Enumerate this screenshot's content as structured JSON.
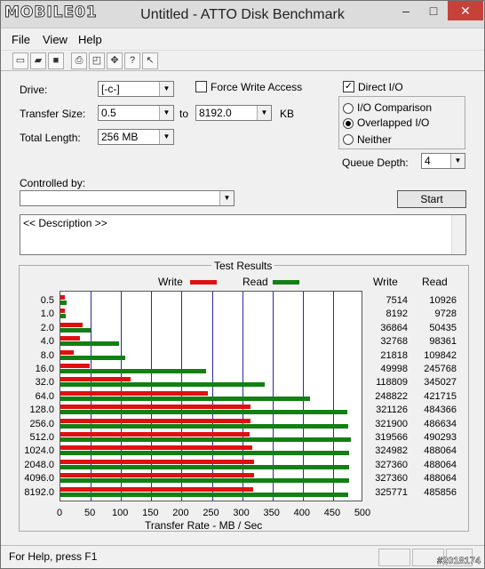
{
  "window": {
    "title": "Untitled - ATTO Disk Benchmark",
    "logo": "MOBILE01"
  },
  "titlebar_buttons": {
    "minimize": "–",
    "maximize": "□",
    "close": "✕"
  },
  "menu": [
    "File",
    "View",
    "Help"
  ],
  "toolbar_icons": [
    "new-icon",
    "open-icon",
    "save-icon",
    "print-icon",
    "print-preview-icon",
    "move-icon",
    "help-icon",
    "context-help-icon"
  ],
  "settings": {
    "drive_label": "Drive:",
    "drive_value": "[-c-]",
    "force_write_label": "Force Write Access",
    "force_write_checked": false,
    "direct_io_label": "Direct I/O",
    "direct_io_checked": true,
    "transfer_label": "Transfer Size:",
    "transfer_from": "0.5",
    "transfer_to_label": "to",
    "transfer_to": "8192.0",
    "transfer_unit": "KB",
    "total_label": "Total Length:",
    "total_value": "256 MB",
    "io_options": [
      "I/O Comparison",
      "Overlapped I/O",
      "Neither"
    ],
    "io_selected": 1,
    "queue_label": "Queue Depth:",
    "queue_value": "4",
    "controlled_label": "Controlled by:",
    "controlled_value": "",
    "start_label": "Start",
    "description": "<< Description >>"
  },
  "results": {
    "title": "Test Results",
    "legend_write": "Write",
    "legend_read": "Read",
    "col_write": "Write",
    "col_read": "Read",
    "xlabel": "Transfer Rate - MB / Sec",
    "colors": {
      "write": "#e01010",
      "read": "#128012"
    }
  },
  "chart_data": {
    "type": "bar",
    "orientation": "horizontal",
    "categories": [
      "0.5",
      "1.0",
      "2.0",
      "4.0",
      "8.0",
      "16.0",
      "32.0",
      "64.0",
      "128.0",
      "256.0",
      "512.0",
      "1024.0",
      "2048.0",
      "4096.0",
      "8192.0"
    ],
    "series": [
      {
        "name": "Write",
        "values": [
          7514,
          8192,
          36864,
          32768,
          21818,
          49998,
          118809,
          248822,
          321126,
          321900,
          319566,
          324982,
          327360,
          327360,
          325771
        ]
      },
      {
        "name": "Read",
        "values": [
          10926,
          9728,
          50435,
          98361,
          109842,
          245768,
          345027,
          421715,
          484366,
          486634,
          490293,
          488064,
          488064,
          488064,
          485856
        ]
      }
    ],
    "xticks": [
      "0",
      "50",
      "100",
      "150",
      "200",
      "250",
      "300",
      "350",
      "400",
      "450",
      "500"
    ],
    "xlim": [
      0,
      500
    ],
    "xlabel": "Transfer Rate - MB / Sec"
  },
  "status": {
    "help_text": "For Help, press F1"
  },
  "watermark": "#2018174"
}
